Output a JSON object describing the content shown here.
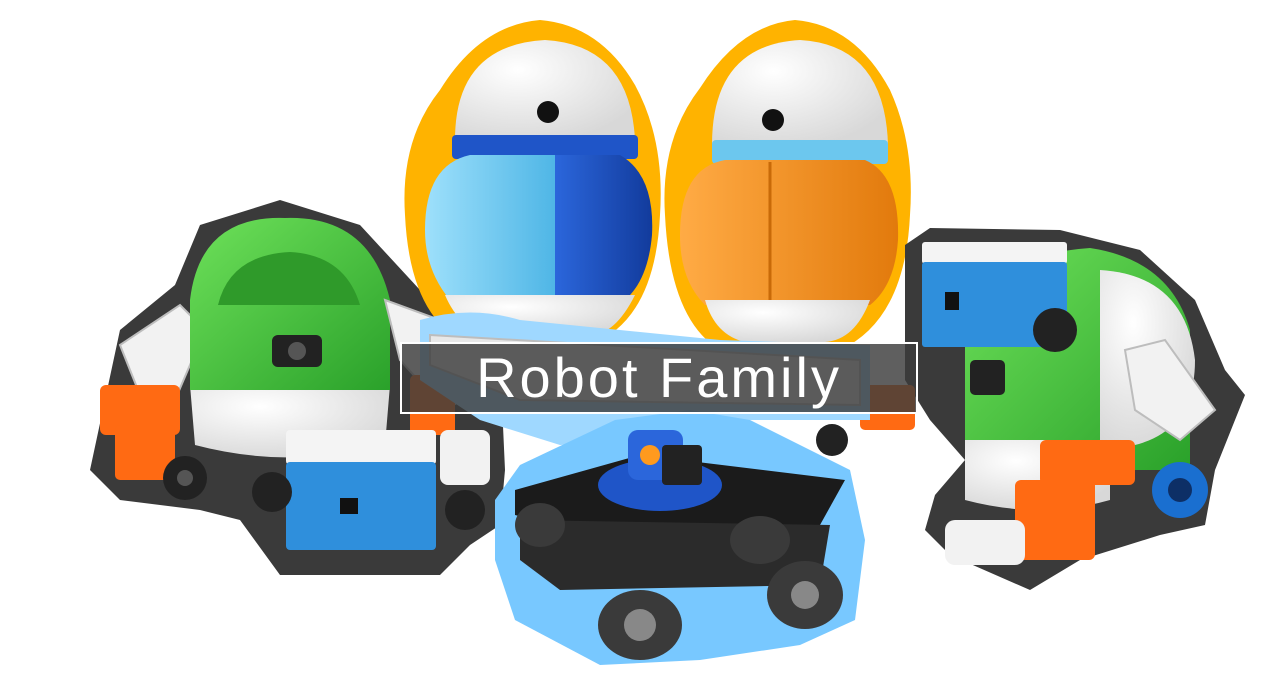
{
  "title": "Robot Family",
  "colors": {
    "title_text": "#ffffff",
    "title_bg": "#3c3c3c",
    "outline_gray": "#3a3a3a",
    "outline_yellow": "#ffb300",
    "outline_blue": "#78c8ff",
    "shell_white": "#f4f4f4",
    "body_light_blue": "#6cc7ee",
    "body_dark_blue": "#1f55c8",
    "body_orange": "#f7901e",
    "body_green": "#3fc33b",
    "accent_orange": "#ff6a13",
    "module_blue": "#2f8fdc"
  }
}
